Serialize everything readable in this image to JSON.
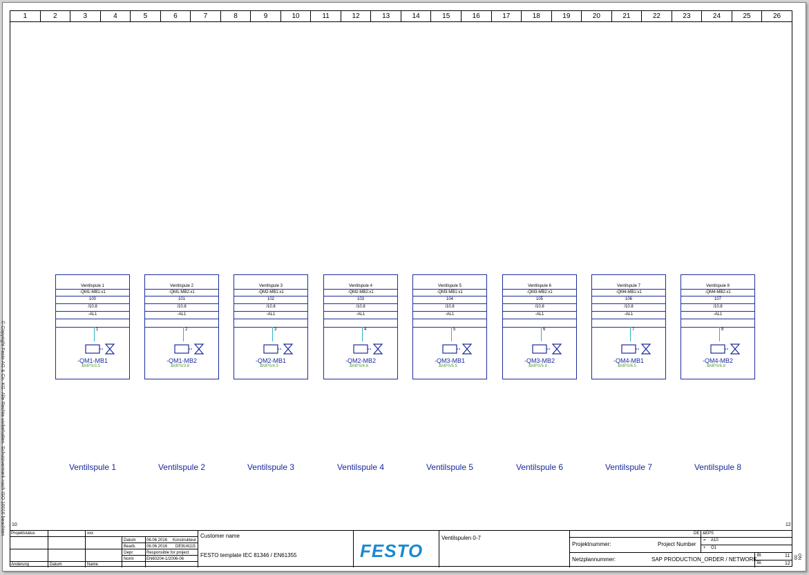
{
  "columns": [
    "1",
    "2",
    "3",
    "4",
    "5",
    "6",
    "7",
    "8",
    "9",
    "10",
    "11",
    "12",
    "13",
    "14",
    "15",
    "16",
    "17",
    "18",
    "19",
    "20",
    "21",
    "22",
    "23",
    "24",
    "25",
    "26"
  ],
  "side_copyright": "© Copyright Festo AG & Co. KG. Alle Rechte vorbehalten. Schutzvermerk nach ISO 16016 beachten",
  "corner_left": "10",
  "corner_right": "12",
  "colors": {
    "module_border": "#1a2a9a",
    "wire": "#2bb0c0",
    "ref_text": "#5a9a3a",
    "logo": "#1a8ad0"
  },
  "modules": [
    {
      "title": "Ventilspule 1",
      "plug": "-QM1-MB1:x1",
      "addr": "100",
      "page": "/10.8",
      "io": "-AL1",
      "pin": "1",
      "tag": "-QM1-MB1",
      "ref": "&MPS/3.5",
      "caption": "Ventilspule 1"
    },
    {
      "title": "Ventilspule 2",
      "plug": "-QM1-MB2:x1",
      "addr": "101",
      "page": "/10.8",
      "io": "-AL1",
      "pin": "2",
      "tag": "-QM1-MB2",
      "ref": "&MPS/3.8",
      "caption": "Ventilspule 2"
    },
    {
      "title": "Ventilspule 3",
      "plug": "-QM2-MB1:x1",
      "addr": "102",
      "page": "/10.8",
      "io": "-AL1",
      "pin": "3",
      "tag": "-QM2-MB1",
      "ref": "&MPS/4.5",
      "caption": "Ventilspule 3"
    },
    {
      "title": "Ventilspule 4",
      "plug": "-QM2-MB2:x1",
      "addr": "103",
      "page": "/10.8",
      "io": "-AL1",
      "pin": "4",
      "tag": "-QM2-MB2",
      "ref": "&MPS/4.8",
      "caption": "Ventilspule 4"
    },
    {
      "title": "Ventilspule 5",
      "plug": "-QM3-MB1:x1",
      "addr": "104",
      "page": "/10.8",
      "io": "-AL1",
      "pin": "5",
      "tag": "-QM3-MB1",
      "ref": "&MPS/5.5",
      "caption": "Ventilspule 5"
    },
    {
      "title": "Ventilspule 6",
      "plug": "-QM3-MB2:x1",
      "addr": "105",
      "page": "/10.8",
      "io": "-AL1",
      "pin": "6",
      "tag": "-QM3-MB2",
      "ref": "&MPS/5.8",
      "caption": "Ventilspule 6"
    },
    {
      "title": "Ventilspule 7",
      "plug": "-QM4-MB1:x1",
      "addr": "106",
      "page": "/10.8",
      "io": "-AL1",
      "pin": "7",
      "tag": "-QM4-MB1",
      "ref": "&MPS/6.5",
      "caption": "Ventilspule 7"
    },
    {
      "title": "Ventilspule 8",
      "plug": "-QM4-MB2:x1",
      "addr": "107",
      "page": "/10.8",
      "io": "-AL1",
      "pin": "8",
      "tag": "-QM4-MB2",
      "ref": "&MPS/6.8",
      "caption": "Ventilspule 8"
    }
  ],
  "title_block": {
    "projektstatus_label": "Projektstatus",
    "projektstatus_value": "xxx",
    "datum_label": "Datum",
    "datum_value": "06.06.2016",
    "konstrukteur_label": "Konstrukteur",
    "bearb_label": "Bearb.",
    "bearb_date": "06.06.2016",
    "bearb_user": "DE9U4115",
    "gepr_label": "Gepr",
    "gepr_value": "Responsible for project",
    "norm_label": "Norm",
    "norm_value": "EN60204-1/2006-06",
    "aenderung_label": "Änderung",
    "datum2_label": "Datum",
    "name_label": "Name",
    "customer": "Customer name",
    "template": "FESTO template IEC 81346 / EN61355",
    "logo": "FESTO",
    "page_title": "Ventilspulen 0-7",
    "lang": "DE",
    "code": "&EPS",
    "projektnummer_label": "Projektnummer:",
    "projektnummer_value": "Project Number",
    "eq_sign": "=",
    "eq_value": "A10",
    "plus_sign": "+",
    "plus_value": "O1",
    "netzplan_label": "Netzplannummer:",
    "netzplan_value": "SAP PRODUCTION_ORDER / NETWORK",
    "bl_label": "Bl.",
    "bl_value": "11",
    "bl2_label": "Bl.",
    "bl2_value": "12",
    "edge_code": "00 NO"
  }
}
